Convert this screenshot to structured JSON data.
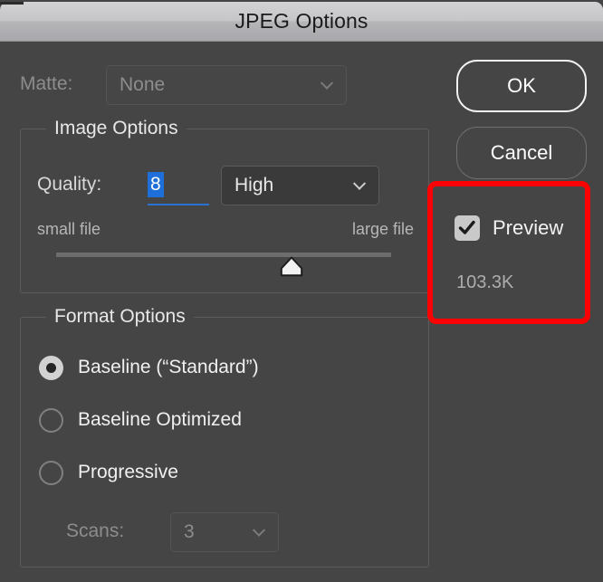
{
  "window": {
    "title": "JPEG Options"
  },
  "matte": {
    "label": "Matte:",
    "value": "None",
    "chevron_icon": "chevron-down-icon"
  },
  "image_options": {
    "legend": "Image Options",
    "quality": {
      "label": "Quality:",
      "value": "8",
      "preset": "High",
      "chevron_icon": "chevron-down-icon"
    },
    "slider": {
      "left_label": "small file",
      "right_label": "large file",
      "value": 8,
      "min": 0,
      "max": 12,
      "thumb_icon": "slider-thumb-icon"
    }
  },
  "format_options": {
    "legend": "Format Options",
    "radios": [
      {
        "label": "Baseline (“Standard”)",
        "selected": true
      },
      {
        "label": "Baseline Optimized",
        "selected": false
      },
      {
        "label": "Progressive",
        "selected": false
      }
    ],
    "scans": {
      "label": "Scans:",
      "value": "3",
      "chevron_icon": "chevron-down-icon"
    }
  },
  "actions": {
    "ok_label": "OK",
    "cancel_label": "Cancel",
    "preview_label": "Preview",
    "preview_checked": true,
    "check_icon": "checkmark-icon",
    "file_size": "103.3K"
  },
  "annotation": {
    "highlight_color": "#fe0000"
  }
}
